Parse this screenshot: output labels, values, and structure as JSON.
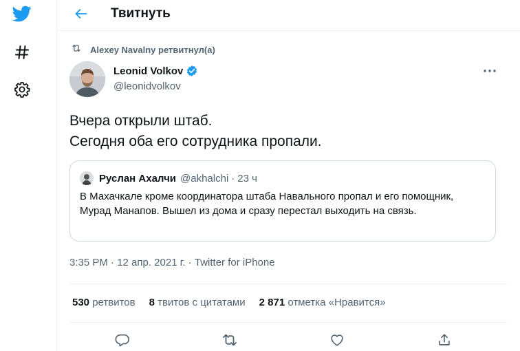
{
  "header": {
    "title": "Твитнуть"
  },
  "retweet": {
    "text": "Alexey Navalny ретвитнул(а)"
  },
  "author": {
    "name": "Leonid Volkov",
    "handle": "@leonidvolkov"
  },
  "tweet": {
    "lines": [
      "Вчера открыли штаб.",
      "Сегодня оба его сотрудника пропали."
    ]
  },
  "quote": {
    "name": "Руслан Ахалчи",
    "handle": "@akhalchi",
    "dot": "·",
    "time": "23 ч",
    "text": "В Махачкале кроме координатора штаба Навального пропал и его помощник, Мурад Манапов. Вышел из дома и сразу перестал выходить на связь."
  },
  "meta": {
    "text": "3:35 PM · 12 апр. 2021 г. · Twitter for iPhone"
  },
  "stats": [
    {
      "count": "530",
      "label": "ретвитов"
    },
    {
      "count": "8",
      "label": "твитов с цитатами"
    },
    {
      "count": "2 871",
      "label": "отметка «Нравится»"
    }
  ],
  "icons": {
    "logo": "twitter-bird-icon",
    "explore": "hashtag-icon",
    "settings": "gear-icon",
    "back": "back-arrow-icon",
    "more": "more-horizontal-icon",
    "reply": "reply-icon",
    "retweet": "retweet-icon",
    "like": "heart-icon",
    "share": "share-icon"
  },
  "colors": {
    "accent": "#1d9bf0",
    "text": "#0f1419",
    "muted": "#536471",
    "border": "#cfd9de"
  }
}
